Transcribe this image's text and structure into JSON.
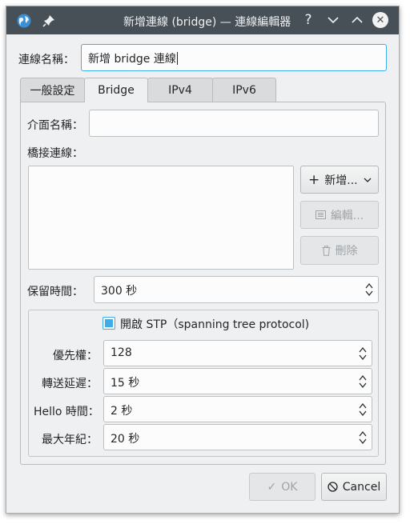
{
  "window": {
    "title": "新增連線 (bridge) — 連線編輯器",
    "help_glyph": "?",
    "minimize_glyph": "∨",
    "maximize_glyph": "∧",
    "close_glyph": "✕"
  },
  "connection_name": {
    "label": "連線名稱：",
    "value": "新增 bridge 連線"
  },
  "tabs": [
    {
      "label": "一般設定",
      "active": false
    },
    {
      "label": "Bridge",
      "active": true
    },
    {
      "label": "IPv4",
      "active": false
    },
    {
      "label": "IPv6",
      "active": false
    }
  ],
  "bridge": {
    "interface_name": {
      "label": "介面名稱：",
      "value": ""
    },
    "bridged_connections": {
      "label": "橋接連線：",
      "items": []
    },
    "add_button": {
      "icon": "+",
      "label": "新增...",
      "arrow": "⌄"
    },
    "edit_button": {
      "label": "編輯..."
    },
    "delete_button": {
      "label": "刪除"
    },
    "aging_time": {
      "label": "保留時間：",
      "value": "300 秒"
    },
    "stp": {
      "checkbox_label": "開啟 STP（spanning tree protocol)",
      "checked": true,
      "priority": {
        "label": "優先權：",
        "value": "128"
      },
      "forward_delay": {
        "label": "轉送延遲：",
        "value": "15 秒"
      },
      "hello_time": {
        "label": "Hello 時間：",
        "value": "2 秒"
      },
      "max_age": {
        "label": "最大年紀：",
        "value": "20 秒"
      }
    }
  },
  "footer": {
    "ok_button": {
      "icon": "✓",
      "label": "OK",
      "enabled": false
    },
    "cancel_button": {
      "icon": "⃠",
      "label": "Cancel",
      "enabled": true
    }
  },
  "colors": {
    "accent": "#3daee9",
    "titlebar": "#475057",
    "window_bg": "#eff0f1"
  }
}
